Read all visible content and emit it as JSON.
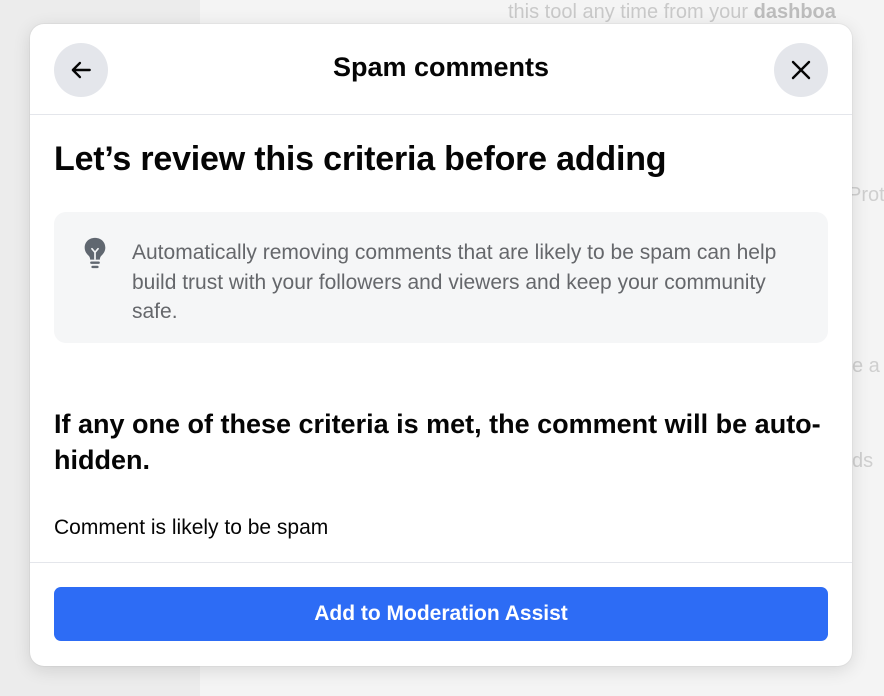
{
  "background": {
    "top_text": "this tool any time from your",
    "top_text_bold": "dashboa",
    "fragments": [
      "Prot",
      "e a",
      "ds"
    ]
  },
  "dialog": {
    "title": "Spam comments",
    "back_icon": "arrow-left-icon",
    "close_icon": "close-icon",
    "heading": "Let’s review this criteria before adding",
    "info": {
      "icon": "lightbulb-icon",
      "text": "Automatically removing comments that are likely to be spam can help build trust with your followers and viewers and keep your community safe."
    },
    "subheading": "If any one of these criteria is met, the comment will be auto-hidden.",
    "criteria": [
      "Comment is likely to be spam"
    ],
    "primary_button": "Add to Moderation Assist"
  },
  "colors": {
    "primary": "#2d6cf5",
    "title_text": "#050505",
    "secondary_text": "#65676b",
    "icon_button_bg": "#e4e6eb",
    "info_box_bg": "#f5f6f7"
  }
}
